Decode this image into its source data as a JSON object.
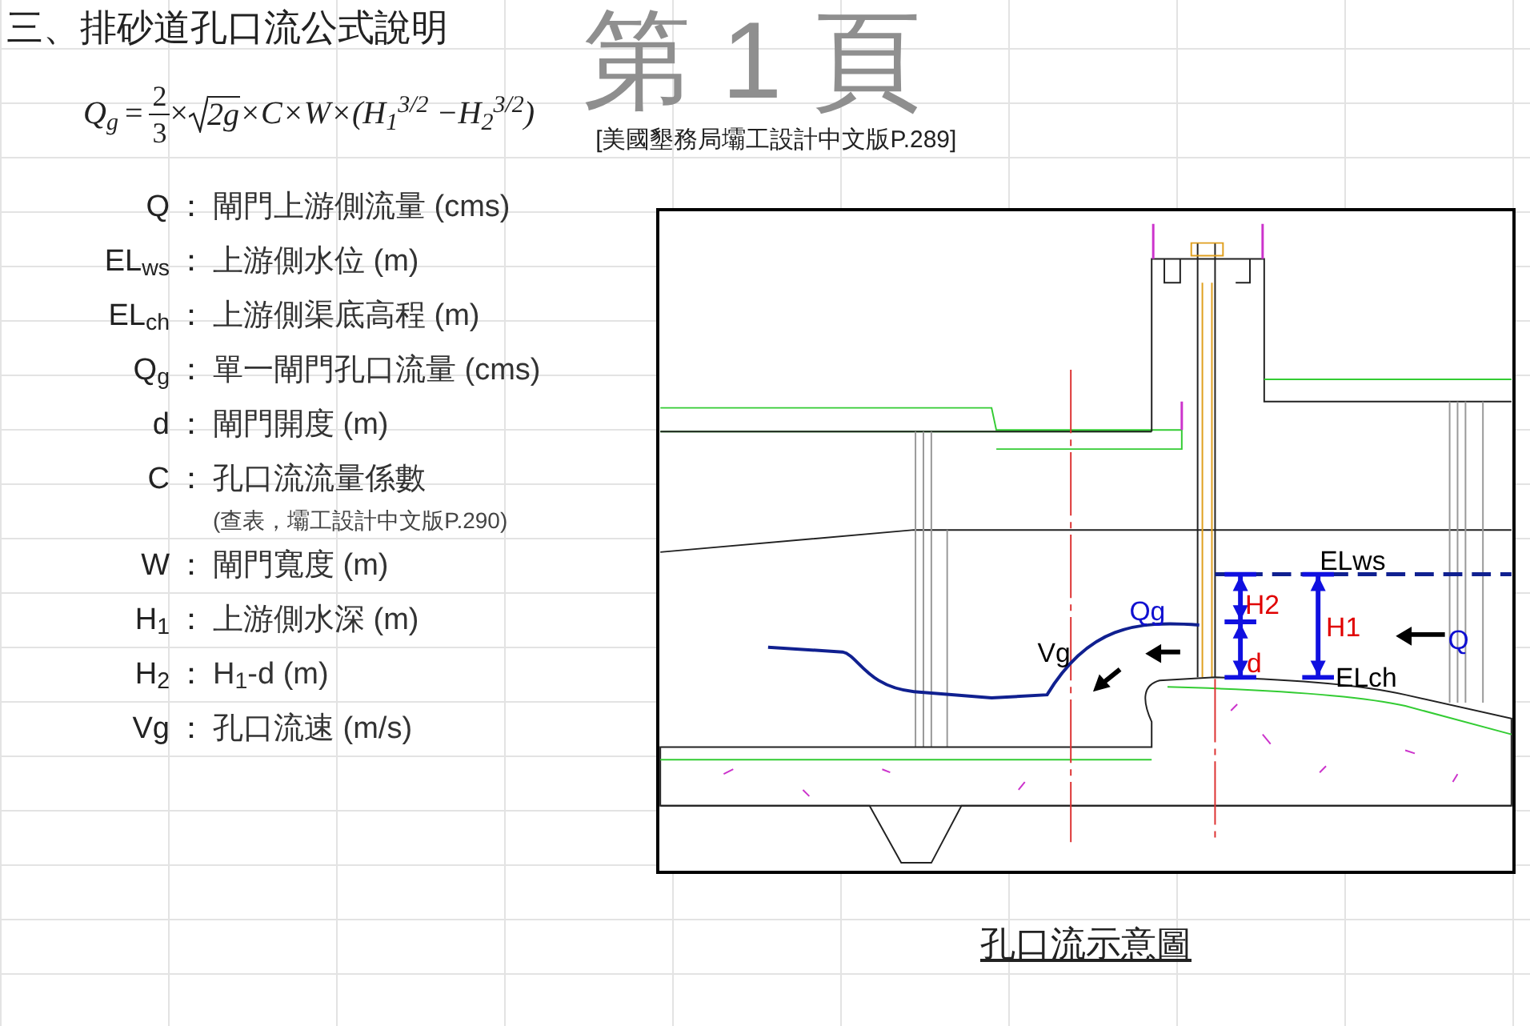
{
  "title": "三、排砂道孔口流公式說明",
  "formula": {
    "lhs": "Q$_{g}$",
    "equals": "=",
    "numerator": "2",
    "denominator": "3",
    "times": "×",
    "radicand": "2g",
    "rest": "×C×W×(H$_{1}$$^{3/2}$ −H$_{2}$$^{3/2}$)"
  },
  "reference": "[美國墾務局壩工設計中文版P.289]",
  "page_label": "第 1 頁",
  "definitions": [
    {
      "kind": "term",
      "symbol": "Q",
      "colon": "：",
      "description": "閘門上游側流量 (cms)"
    },
    {
      "kind": "term",
      "symbol": "EL$_{ws}$",
      "colon": "：",
      "description": "上游側水位 (m)"
    },
    {
      "kind": "term",
      "symbol": "EL$_{ch}$",
      "colon": "：",
      "description": "上游側渠底高程 (m)"
    },
    {
      "kind": "term",
      "symbol": "Q$_{g}$",
      "colon": "：",
      "description": "單一閘門孔口流量 (cms)"
    },
    {
      "kind": "term",
      "symbol": "d",
      "colon": "：",
      "description": "閘門開度 (m)"
    },
    {
      "kind": "term",
      "symbol": "C",
      "colon": "：",
      "description": "孔口流流量係數"
    },
    {
      "kind": "note",
      "description": "(查表，壩工設計中文版P.290)"
    },
    {
      "kind": "term",
      "symbol": "W",
      "colon": "：",
      "description": "閘門寬度 (m)"
    },
    {
      "kind": "term",
      "symbol": "H$_{1}$",
      "colon": "：",
      "description": "上游側水深 (m)"
    },
    {
      "kind": "term",
      "symbol": "H$_{2}$",
      "colon": "：",
      "description": "H$_{1}$-d (m)"
    },
    {
      "kind": "term",
      "symbol": "Vg",
      "colon": "：",
      "description": "孔口流速 (m/s)"
    }
  ],
  "diagram": {
    "elevation_labels": [
      "ELws",
      "ELch"
    ],
    "depth_labels": [
      "H2",
      "H1",
      "d"
    ],
    "flow_labels": [
      "Qg",
      "Q",
      "Vg"
    ],
    "caption": "孔口流示意圖"
  }
}
